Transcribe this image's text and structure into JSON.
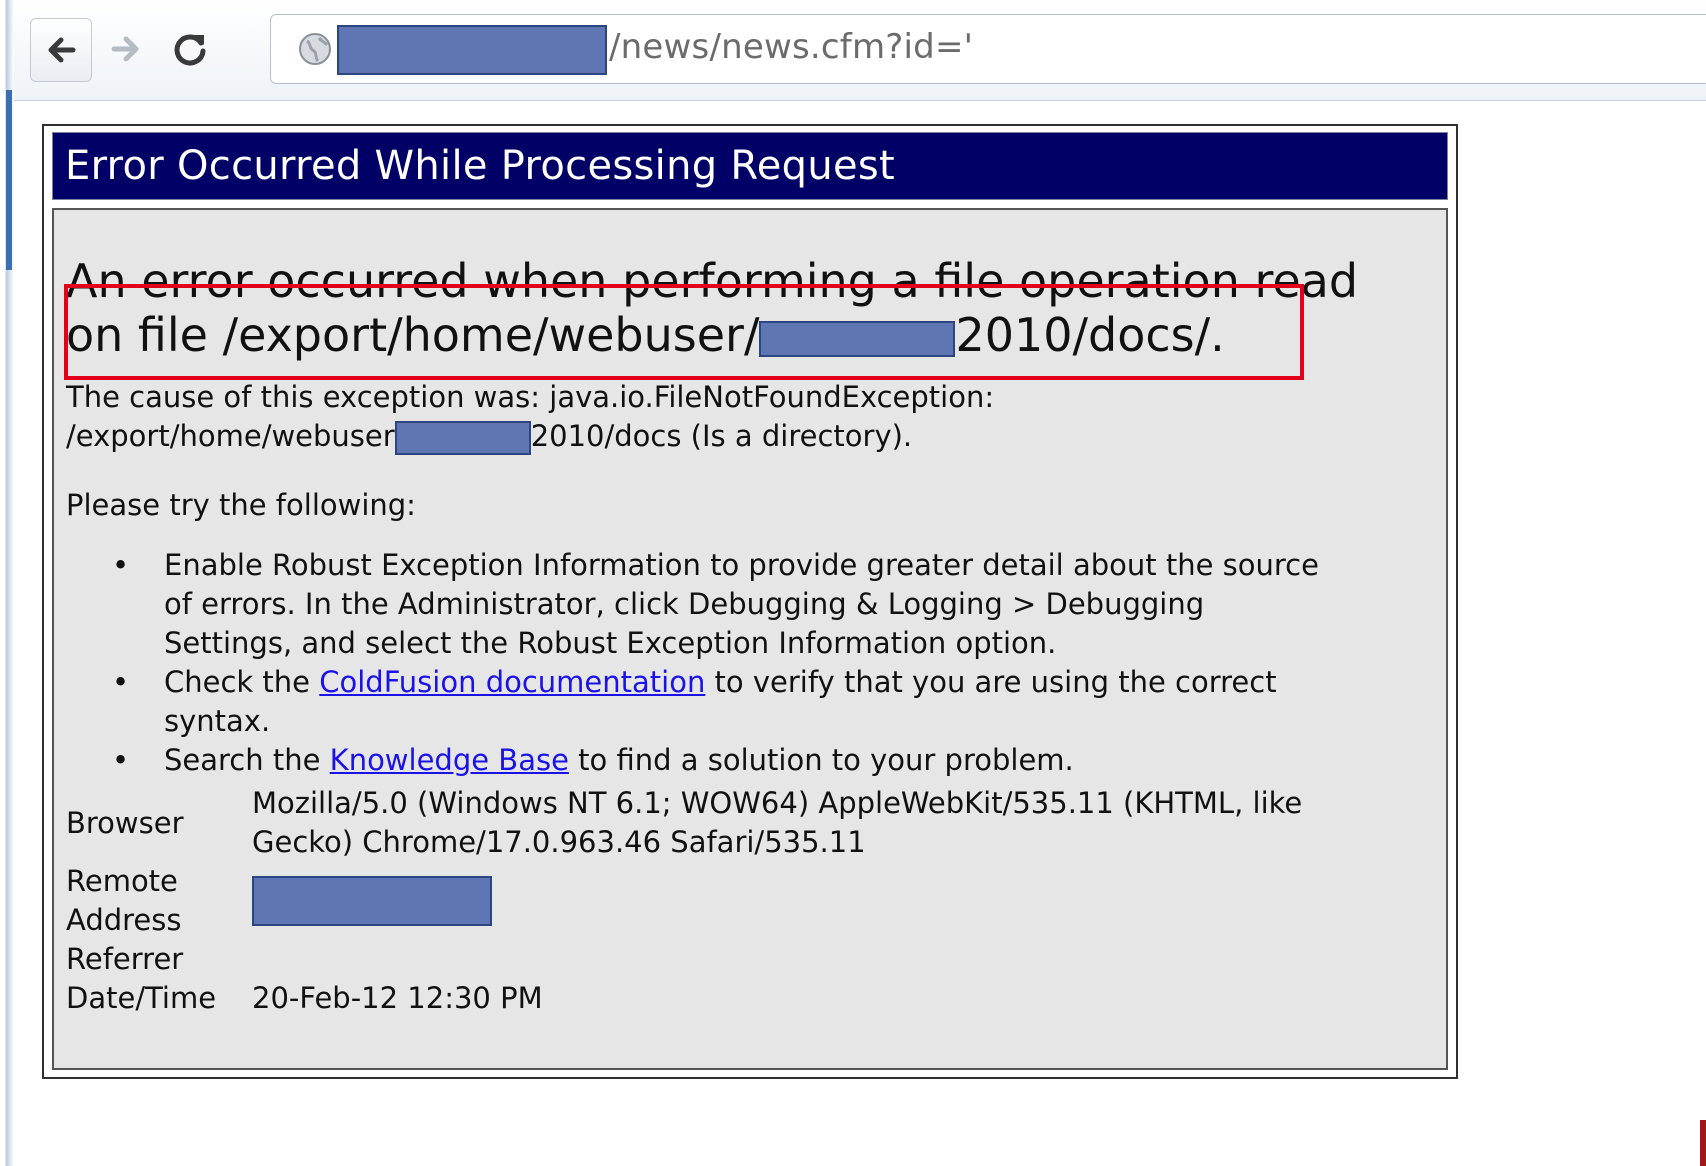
{
  "browser": {
    "url_visible": "/news/news.cfm?id='",
    "icons": {
      "back": "back-arrow-icon",
      "forward": "forward-arrow-icon",
      "reload": "reload-icon",
      "site": "globe-icon"
    }
  },
  "error_page": {
    "title": "Error Occurred While Processing Request",
    "heading": {
      "line1": "An error occurred when performing a file operation read",
      "line2_prefix": "on file /export/home/webuser/",
      "line2_suffix": "2010/docs/."
    },
    "cause": {
      "line1": "The cause of this exception was: java.io.FileNotFoundException:",
      "line2_prefix": "/export/home/webuser",
      "line2_suffix": "2010/docs (Is a directory)."
    },
    "try_label": "Please try the following:",
    "suggestions": {
      "item1": {
        "line1": "Enable Robust Exception Information to provide greater detail about the source",
        "line2": "of errors. In the Administrator, click Debugging & Logging > Debugging",
        "line3": "Settings, and select the Robust Exception Information option."
      },
      "item2": {
        "pre": "Check the ",
        "link": "ColdFusion documentation",
        "post": " to verify that you are using the correct",
        "line2": "syntax."
      },
      "item3": {
        "pre": "Search the ",
        "link": "Knowledge Base",
        "post": " to find a solution to your problem."
      }
    },
    "info": {
      "browser_label": "Browser",
      "browser_value_line1": "Mozilla/5.0 (Windows NT 6.1; WOW64) AppleWebKit/535.11 (KHTML, like",
      "browser_value_line2": "Gecko) Chrome/17.0.963.46 Safari/535.11",
      "remote_label_line1": "Remote",
      "remote_label_line2": "Address",
      "referrer_label": "Referrer",
      "datetime_label": "Date/Time",
      "datetime_value": "20-Feb-12 12:30 PM"
    }
  },
  "colors": {
    "title_bar": "#000066",
    "redaction": "#5f76b5",
    "highlight": "#e3001b",
    "link": "#1a12e6"
  }
}
